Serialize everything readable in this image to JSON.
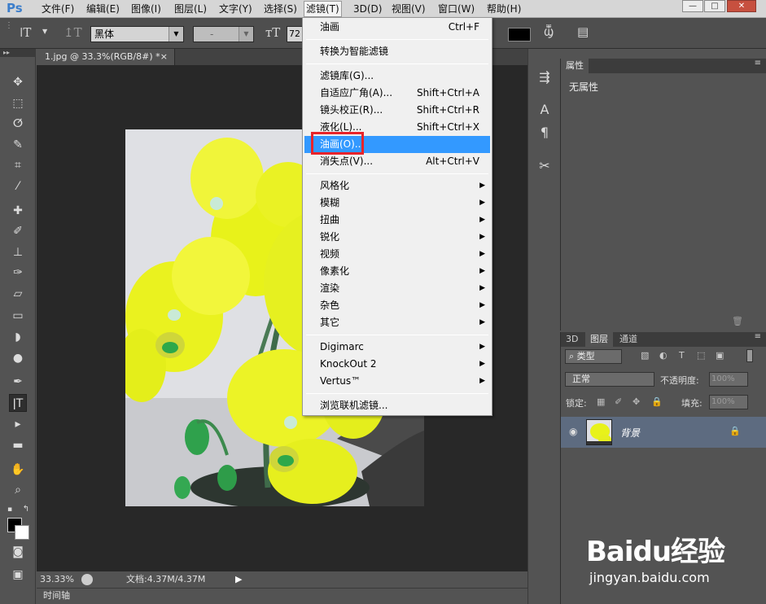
{
  "app": {
    "logo": "Ps"
  },
  "menubar": {
    "items": [
      "文件(F)",
      "编辑(E)",
      "图像(I)",
      "图层(L)",
      "文字(Y)",
      "选择(S)",
      "滤镜(T)",
      "3D(D)",
      "视图(V)",
      "窗口(W)",
      "帮助(H)"
    ],
    "active_index": 6
  },
  "window_controls": {
    "minimize": "—",
    "maximize": "□",
    "close": "✕"
  },
  "options_bar": {
    "font_family": "黑体",
    "font_style": "-",
    "font_size": "72",
    "text_color": "#000000"
  },
  "document": {
    "tab_title": "1.jpg @ 33.3%(RGB/8#) *",
    "tab_close": "×",
    "zoom": "33.33%",
    "doc_info": "文档:4.37M/4.37M"
  },
  "timeline": {
    "label": "时间轴"
  },
  "properties_panel": {
    "tab": "属性",
    "content": "无属性"
  },
  "layers_panel": {
    "tabs": [
      "3D",
      "图层",
      "通道"
    ],
    "active_tab_index": 1,
    "filter_type": "类型",
    "blend_mode": "正常",
    "opacity_label": "不透明度:",
    "opacity_value": "100%",
    "lock_label": "锁定:",
    "fill_label": "填充:",
    "fill_value": "100%",
    "layers": [
      {
        "name": "背景",
        "visible": true,
        "locked": true
      }
    ]
  },
  "filter_menu": {
    "items": [
      {
        "label": "油画",
        "shortcut": "Ctrl+F"
      },
      {
        "sep": true
      },
      {
        "label": "转换为智能滤镜"
      },
      {
        "sep": true
      },
      {
        "label": "滤镜库(G)..."
      },
      {
        "label": "自适应广角(A)...",
        "shortcut": "Shift+Ctrl+A"
      },
      {
        "label": "镜头校正(R)...",
        "shortcut": "Shift+Ctrl+R"
      },
      {
        "label": "液化(L)...",
        "shortcut": "Shift+Ctrl+X"
      },
      {
        "label": "油画(O)...",
        "highlighted": true
      },
      {
        "label": "消失点(V)...",
        "shortcut": "Alt+Ctrl+V"
      },
      {
        "sep": true
      },
      {
        "label": "风格化",
        "submenu": true
      },
      {
        "label": "模糊",
        "submenu": true
      },
      {
        "label": "扭曲",
        "submenu": true
      },
      {
        "label": "锐化",
        "submenu": true
      },
      {
        "label": "视频",
        "submenu": true
      },
      {
        "label": "像素化",
        "submenu": true
      },
      {
        "label": "渲染",
        "submenu": true
      },
      {
        "label": "杂色",
        "submenu": true
      },
      {
        "label": "其它",
        "submenu": true
      },
      {
        "sep": true
      },
      {
        "label": "Digimarc",
        "submenu": true
      },
      {
        "label": "KnockOut 2",
        "submenu": true
      },
      {
        "label": "Vertus™",
        "submenu": true
      },
      {
        "sep": true
      },
      {
        "label": "浏览联机滤镜..."
      }
    ]
  },
  "watermark": {
    "brand": "Baidu经验",
    "url": "jingyan.baidu.com"
  },
  "colors": {
    "accent_highlight": "#3399ff",
    "red_annotation": "#e8232a",
    "layer_selected": "#5d6b80"
  }
}
